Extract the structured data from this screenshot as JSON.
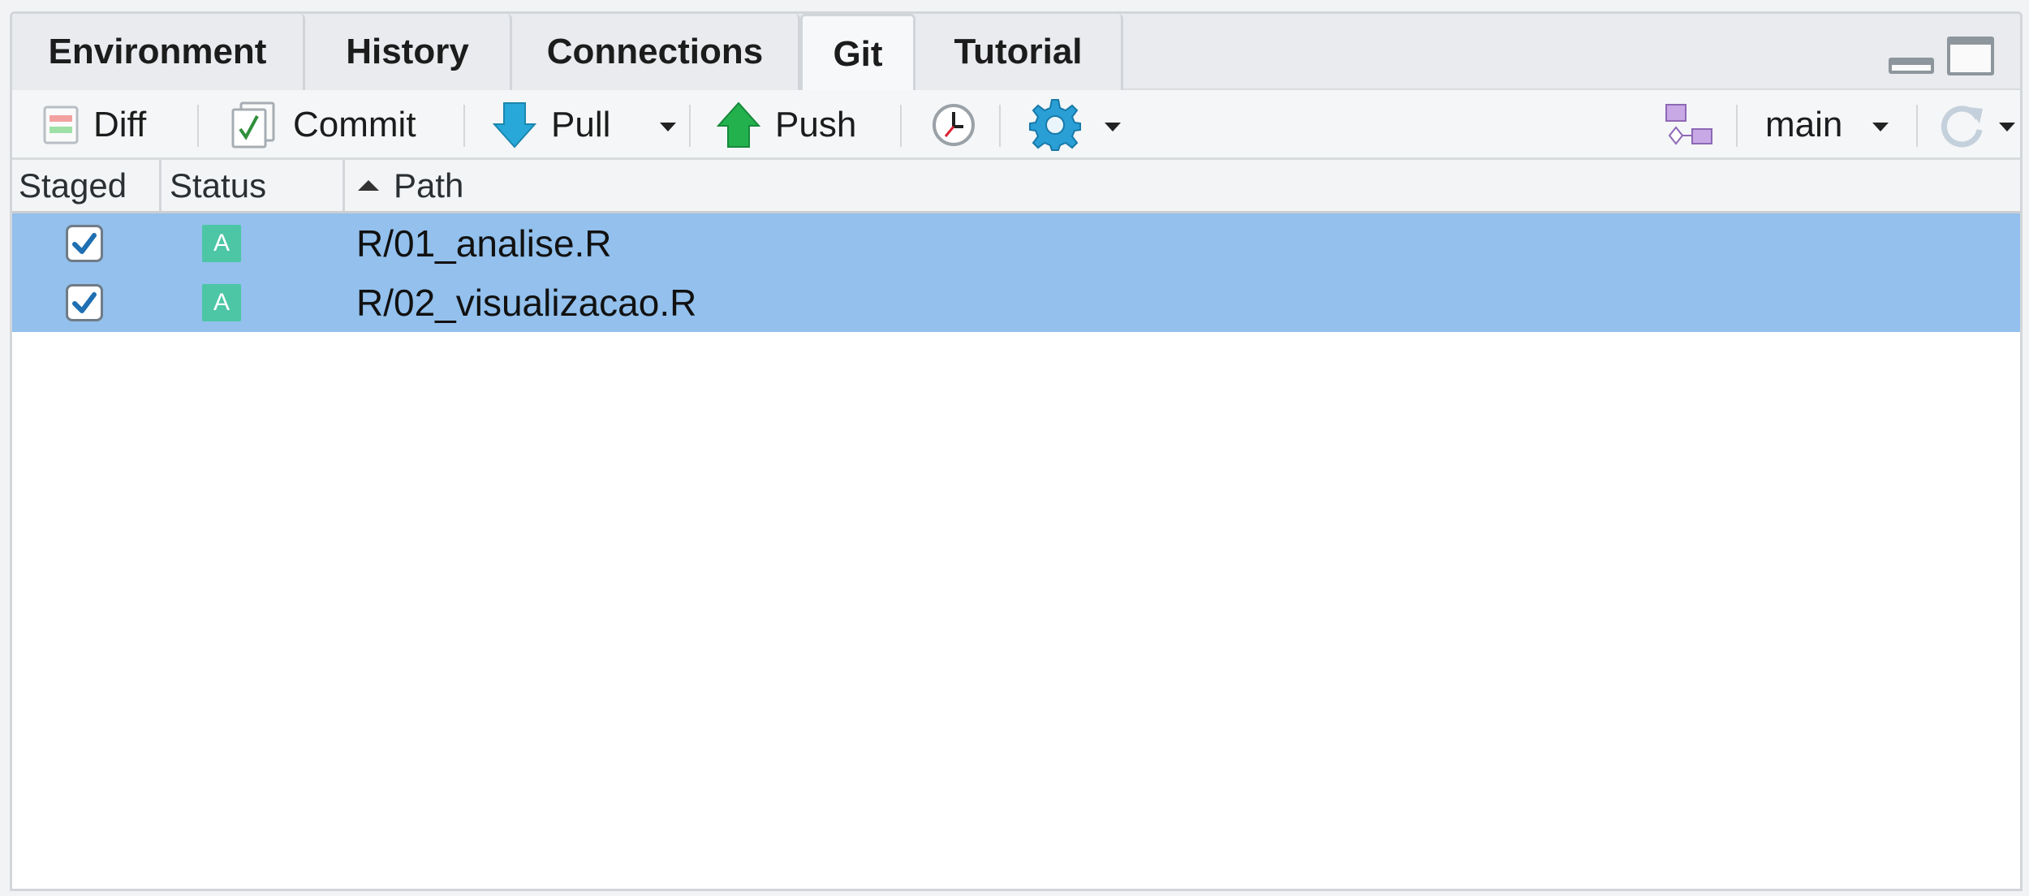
{
  "tabs": [
    {
      "label": "Environment",
      "active": false
    },
    {
      "label": "History",
      "active": false
    },
    {
      "label": "Connections",
      "active": false
    },
    {
      "label": "Git",
      "active": true
    },
    {
      "label": "Tutorial",
      "active": false
    }
  ],
  "toolbar": {
    "diff_label": "Diff",
    "commit_label": "Commit",
    "pull_label": "Pull",
    "push_label": "Push",
    "branch_label": "main"
  },
  "table": {
    "columns": [
      "Staged",
      "Status",
      "Path"
    ],
    "sort_column": "Path",
    "sort_direction": "ascending",
    "rows": [
      {
        "staged": true,
        "status": "A",
        "path": "R/01_analise.R",
        "selected": true
      },
      {
        "staged": true,
        "status": "A",
        "path": "R/02_visualizacao.R",
        "selected": true
      }
    ]
  },
  "colors": {
    "selected_row": "#93c0ec",
    "status_added": "#4dc6a6",
    "checkmark": "#1f6fb2"
  },
  "icons": {
    "diff": "diff-icon",
    "commit": "commit-icon",
    "pull": "pull-arrow-icon",
    "push": "push-arrow-icon",
    "history": "clock-icon",
    "more": "gear-icon",
    "branch": "branch-icon",
    "refresh": "refresh-icon",
    "minimize": "minimize-icon",
    "maximize": "maximize-icon"
  }
}
